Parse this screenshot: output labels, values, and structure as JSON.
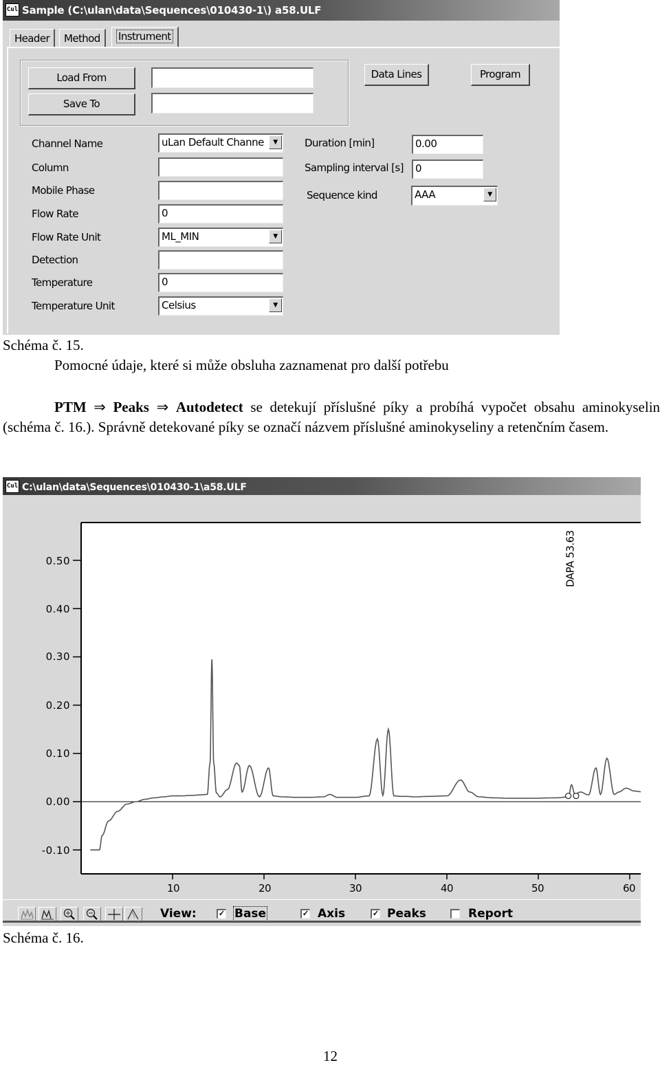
{
  "window1": {
    "title": "Sample (C:\\ulan\\data\\Sequences\\010430-1\\) a58.ULF",
    "app_icon": "ulan-app-icon",
    "tabs": [
      {
        "label": "Header",
        "active": false
      },
      {
        "label": "Method",
        "active": false
      },
      {
        "label": "Instrument",
        "active": true
      }
    ],
    "buttons": {
      "load_from": "Load From",
      "save_to": "Save To",
      "data_lines": "Data Lines",
      "program": "Program"
    },
    "load_from_value": "",
    "save_to_value": "",
    "left_fields": [
      {
        "label": "Channel Name",
        "value": "uLan Default Channe",
        "type": "select"
      },
      {
        "label": "Column",
        "value": "",
        "type": "text"
      },
      {
        "label": "Mobile Phase",
        "value": "",
        "type": "text"
      },
      {
        "label": "Flow Rate",
        "value": "0",
        "type": "text"
      },
      {
        "label": "Flow Rate Unit",
        "value": "ML_MIN",
        "type": "select"
      },
      {
        "label": "Detection",
        "value": "",
        "type": "text"
      },
      {
        "label": "Temperature",
        "value": "0",
        "type": "text"
      },
      {
        "label": "Temperature Unit",
        "value": "Celsius",
        "type": "select"
      }
    ],
    "right_fields": [
      {
        "label": "Duration [min]",
        "value": "0.00",
        "type": "text"
      },
      {
        "label": "Sampling interval [s]",
        "value": "0",
        "type": "text"
      },
      {
        "label": "Sequence kind",
        "value": "AAA",
        "type": "select"
      }
    ],
    "dropdown_arrow": "▼"
  },
  "doc": {
    "caption15": "Schéma č. 15.",
    "note15": "Pomocné údaje, které si může obsluha  zaznamenat pro další potřebu",
    "para_bold1": "PTM",
    "para_arrow": "⇒",
    "para_bold2": "Peaks",
    "para_bold3": "Autodetect",
    "para_text": " se detekují příslušné píky a probíhá vypočet obsahu aminokyselin (schéma č. 16.). Správně detekované píky se označí názvem příslušné aminokyseliny a retenčním časem.",
    "caption16": "Schéma č. 16.",
    "page_number": "12"
  },
  "window2": {
    "title": "C:\\ulan\\data\\Sequences\\010430-1\\a58.ULF",
    "toolbar": {
      "tools": [
        "autoscale-icon",
        "peaks-scale-icon",
        "zoom-in-icon",
        "zoom-out-icon",
        "crosshair-icon",
        "baseline-icon"
      ],
      "view_label": "View:",
      "checks": [
        {
          "label": "Base",
          "checked": true,
          "focused": true
        },
        {
          "label": "Axis",
          "checked": true,
          "focused": false
        },
        {
          "label": "Peaks",
          "checked": true,
          "focused": false
        },
        {
          "label": "Report",
          "checked": false,
          "focused": false
        }
      ],
      "check_mark": "✓"
    }
  },
  "chart_data": {
    "type": "line",
    "title": "",
    "xlabel": "",
    "ylabel": "",
    "xlim": [
      1,
      61.5
    ],
    "ylim": [
      -0.15,
      0.58
    ],
    "x_ticks": [
      10,
      20,
      30,
      40,
      50,
      60
    ],
    "y_ticks": [
      0.5,
      0.4,
      0.3,
      0.2,
      0.1,
      0.0,
      -0.1
    ],
    "y_tick_labels": [
      "0.50",
      "0.40",
      "0.30",
      "0.20",
      "0.10",
      "0.00",
      "-0.10"
    ],
    "baseline": 0.0,
    "grid": false,
    "annotations": [
      {
        "text": "DAPA 53.63",
        "x": 53.63,
        "orientation": "vertical"
      }
    ],
    "series": [
      {
        "name": "chromatogram",
        "x": [
          1.0,
          2.0,
          2.3,
          3.0,
          4.0,
          5.0,
          6.0,
          7.0,
          8.0,
          9.0,
          10.0,
          11.0,
          12.0,
          13.0,
          13.8,
          14.1,
          14.3,
          14.5,
          14.8,
          15.2,
          16.0,
          17.0,
          17.3,
          17.6,
          18.4,
          19.5,
          20.5,
          21.0,
          22.0,
          23.5,
          25.0,
          26.5,
          27.2,
          28.0,
          30.0,
          31.5,
          32.4,
          33.0,
          33.6,
          34.2,
          35.0,
          35.5,
          36.5,
          38.0,
          40.0,
          41.5,
          42.5,
          43.5,
          45.0,
          47.0,
          49.0,
          52.0,
          53.3,
          53.63,
          54.0,
          54.6,
          55.5,
          56.3,
          56.8,
          57.5,
          58.3,
          58.8,
          59.6,
          60.5,
          61.5
        ],
        "y": [
          -0.1,
          -0.1,
          -0.07,
          -0.04,
          -0.02,
          -0.005,
          0.0,
          0.005,
          0.008,
          0.01,
          0.012,
          0.012,
          0.013,
          0.014,
          0.015,
          0.08,
          0.295,
          0.08,
          0.018,
          0.01,
          0.025,
          0.08,
          0.075,
          0.02,
          0.075,
          0.01,
          0.07,
          0.012,
          0.01,
          0.009,
          0.009,
          0.01,
          0.015,
          0.009,
          0.009,
          0.012,
          0.13,
          0.013,
          0.15,
          0.012,
          0.011,
          0.011,
          0.01,
          0.011,
          0.012,
          0.045,
          0.02,
          0.01,
          0.008,
          0.007,
          0.007,
          0.008,
          0.01,
          0.035,
          0.015,
          0.02,
          0.014,
          0.07,
          0.015,
          0.09,
          0.015,
          0.02,
          0.028,
          0.022,
          0.02
        ]
      }
    ]
  }
}
